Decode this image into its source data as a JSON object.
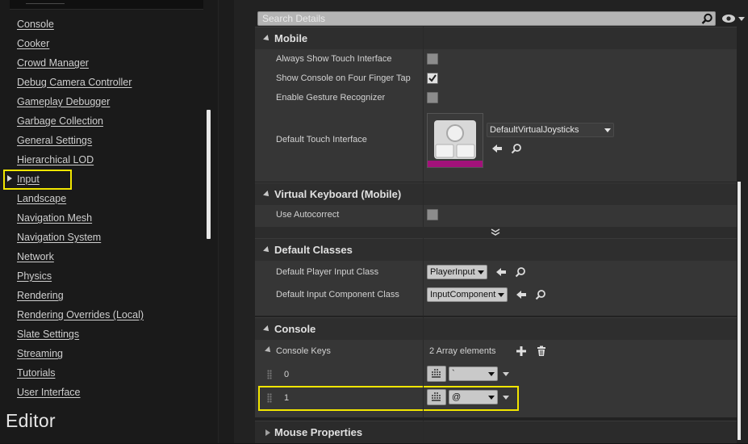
{
  "sidebar": {
    "items": [
      {
        "label": "Console"
      },
      {
        "label": "Cooker"
      },
      {
        "label": "Crowd Manager"
      },
      {
        "label": "Debug Camera Controller"
      },
      {
        "label": "Gameplay Debugger"
      },
      {
        "label": "Garbage Collection"
      },
      {
        "label": "General Settings"
      },
      {
        "label": "Hierarchical LOD"
      },
      {
        "label": "Input"
      },
      {
        "label": "Landscape"
      },
      {
        "label": "Navigation Mesh"
      },
      {
        "label": "Navigation System"
      },
      {
        "label": "Network"
      },
      {
        "label": "Physics"
      },
      {
        "label": "Rendering"
      },
      {
        "label": "Rendering Overrides (Local)"
      },
      {
        "label": "Slate Settings"
      },
      {
        "label": "Streaming"
      },
      {
        "label": "Tutorials"
      },
      {
        "label": "User Interface"
      }
    ],
    "selected": "Input",
    "section_title": "Editor"
  },
  "details": {
    "search": {
      "placeholder": "Search Details",
      "value": ""
    },
    "mobile": {
      "title": "Mobile",
      "always_show_touch": {
        "label": "Always Show Touch Interface",
        "checked": false
      },
      "show_console_four_finger": {
        "label": "Show Console on Four Finger Tap",
        "checked": true
      },
      "enable_gesture": {
        "label": "Enable Gesture Recognizer",
        "checked": false
      },
      "default_touch_interface": {
        "label": "Default Touch Interface",
        "value": "DefaultVirtualJoysticks"
      }
    },
    "virtual_keyboard": {
      "title": "Virtual Keyboard (Mobile)",
      "use_autocorrect": {
        "label": "Use Autocorrect",
        "checked": false
      }
    },
    "default_classes": {
      "title": "Default Classes",
      "player_input_class": {
        "label": "Default Player Input Class",
        "value": "PlayerInput"
      },
      "input_component_class": {
        "label": "Default Input Component Class",
        "value": "InputComponent"
      }
    },
    "console": {
      "title": "Console",
      "console_keys": {
        "label": "Console Keys",
        "count_text": "2 Array elements"
      },
      "elements": [
        {
          "index": "0",
          "key": "`"
        },
        {
          "index": "1",
          "key": "@"
        }
      ]
    },
    "mouse_properties": {
      "title": "Mouse Properties"
    }
  },
  "colors": {
    "highlight": "#f2e600",
    "panel_bg": "#222222",
    "row_bg": "#363636",
    "header_bg": "#2e2e2e"
  }
}
